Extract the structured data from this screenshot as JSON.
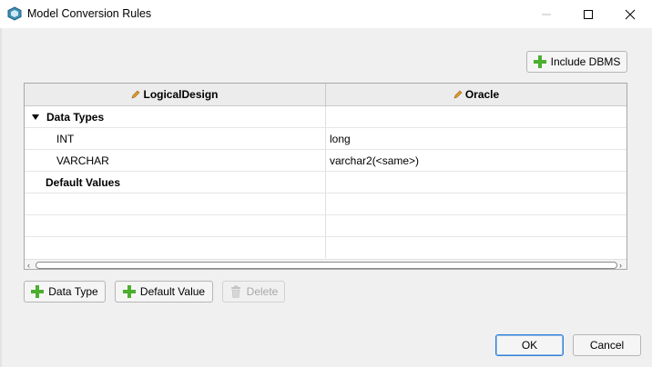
{
  "window": {
    "title": "Model Conversion Rules"
  },
  "toolbar": {
    "include_dbms_label": "Include DBMS"
  },
  "table": {
    "columns": [
      "LogicalDesign",
      "Oracle"
    ],
    "rows": [
      {
        "label": "Data Types",
        "value": ""
      },
      {
        "label": "INT",
        "value": "long"
      },
      {
        "label": "VARCHAR",
        "value": "varchar2(<same>)"
      },
      {
        "label": "Default Values",
        "value": ""
      }
    ]
  },
  "actions": {
    "data_type_label": "Data Type",
    "default_value_label": "Default Value",
    "delete_label": "Delete"
  },
  "footer": {
    "ok_label": "OK",
    "cancel_label": "Cancel"
  },
  "colors": {
    "plus_green": "#4caf2e",
    "pencil_orange": "#e09a2a",
    "accent": "#2f7ed8"
  }
}
